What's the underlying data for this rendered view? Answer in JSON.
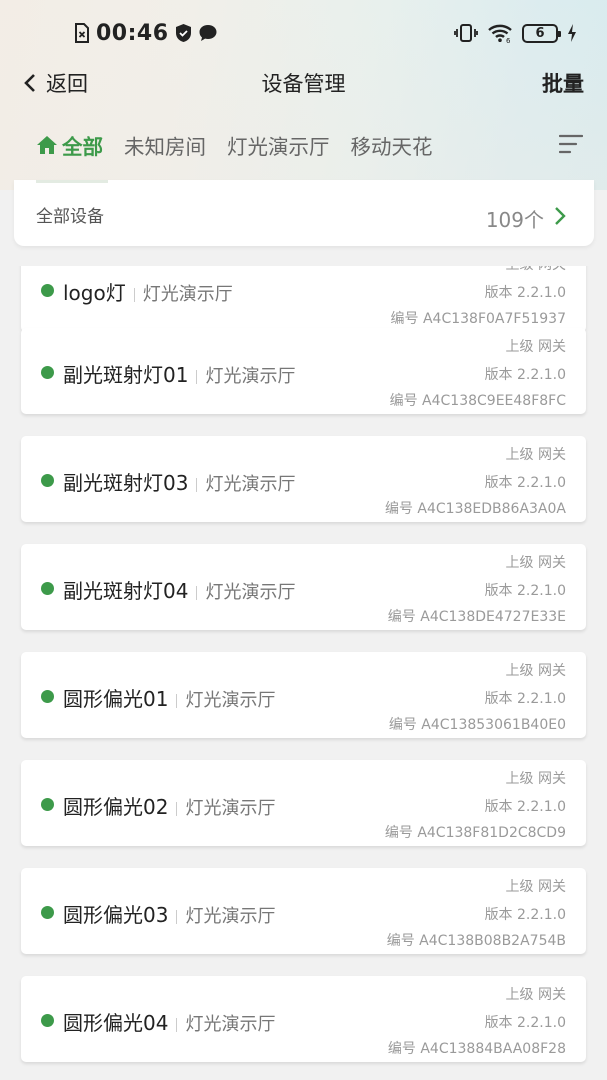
{
  "status_bar": {
    "time": "00:46",
    "battery_level": "6"
  },
  "header": {
    "back_label": "返回",
    "title": "设备管理",
    "batch_label": "批量"
  },
  "tabs": [
    {
      "label": "全部",
      "active": true,
      "icon": "home-icon"
    },
    {
      "label": "未知房间",
      "active": false
    },
    {
      "label": "灯光演示厅",
      "active": false
    },
    {
      "label": "移动天花",
      "active": false
    }
  ],
  "summary": {
    "label": "全部设备",
    "count": "109个"
  },
  "labels": {
    "parent_prefix": "上级",
    "version_prefix": "版本",
    "serial_prefix": "编号"
  },
  "devices": [
    {
      "name": "logo灯",
      "room": "灯光演示厅",
      "parent": "网关",
      "version": "2.2.1.0",
      "serial": "A4C138F0A7F51937"
    },
    {
      "name": "副光斑射灯01",
      "room": "灯光演示厅",
      "parent": "网关",
      "version": "2.2.1.0",
      "serial": "A4C138C9EE48F8FC"
    },
    {
      "name": "副光斑射灯03",
      "room": "灯光演示厅",
      "parent": "网关",
      "version": "2.2.1.0",
      "serial": "A4C138EDB86A3A0A"
    },
    {
      "name": "副光斑射灯04",
      "room": "灯光演示厅",
      "parent": "网关",
      "version": "2.2.1.0",
      "serial": "A4C138DE4727E33E"
    },
    {
      "name": "圆形偏光01",
      "room": "灯光演示厅",
      "parent": "网关",
      "version": "2.2.1.0",
      "serial": "A4C13853061B40E0"
    },
    {
      "name": "圆形偏光02",
      "room": "灯光演示厅",
      "parent": "网关",
      "version": "2.2.1.0",
      "serial": "A4C138F81D2C8CD9"
    },
    {
      "name": "圆形偏光03",
      "room": "灯光演示厅",
      "parent": "网关",
      "version": "2.2.1.0",
      "serial": "A4C138B08B2A754B"
    },
    {
      "name": "圆形偏光04",
      "room": "灯光演示厅",
      "parent": "网关",
      "version": "2.2.1.0",
      "serial": "A4C13884BAA08F28"
    }
  ],
  "colors": {
    "accent": "#3d9a4a",
    "online_dot": "#3d9a4a"
  }
}
